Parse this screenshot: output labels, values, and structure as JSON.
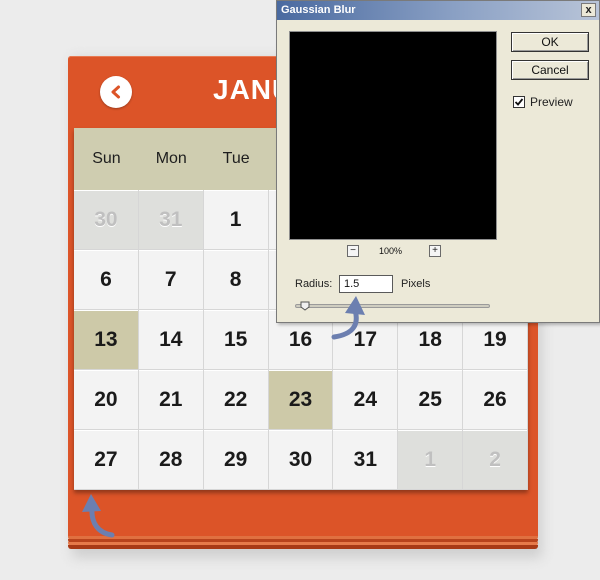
{
  "calendar": {
    "month_title": "JANU",
    "back_icon": "chevron-left-icon",
    "weekdays": [
      "Sun",
      "Mon",
      "Tue",
      "",
      "",
      "",
      ""
    ],
    "days": [
      {
        "label": "30",
        "state": "muted"
      },
      {
        "label": "31",
        "state": "muted"
      },
      {
        "label": "1",
        "state": "normal"
      },
      {
        "label": "",
        "state": "normal"
      },
      {
        "label": "",
        "state": "normal"
      },
      {
        "label": "",
        "state": "normal"
      },
      {
        "label": "",
        "state": "normal"
      },
      {
        "label": "6",
        "state": "normal"
      },
      {
        "label": "7",
        "state": "normal"
      },
      {
        "label": "8",
        "state": "normal"
      },
      {
        "label": "",
        "state": "normal"
      },
      {
        "label": "",
        "state": "normal"
      },
      {
        "label": "",
        "state": "normal"
      },
      {
        "label": "",
        "state": "normal"
      },
      {
        "label": "13",
        "state": "highlight"
      },
      {
        "label": "14",
        "state": "normal"
      },
      {
        "label": "15",
        "state": "normal"
      },
      {
        "label": "16",
        "state": "normal"
      },
      {
        "label": "17",
        "state": "normal"
      },
      {
        "label": "18",
        "state": "normal"
      },
      {
        "label": "19",
        "state": "normal"
      },
      {
        "label": "20",
        "state": "normal"
      },
      {
        "label": "21",
        "state": "normal"
      },
      {
        "label": "22",
        "state": "normal"
      },
      {
        "label": "23",
        "state": "highlight"
      },
      {
        "label": "24",
        "state": "normal"
      },
      {
        "label": "25",
        "state": "normal"
      },
      {
        "label": "26",
        "state": "normal"
      },
      {
        "label": "27",
        "state": "normal"
      },
      {
        "label": "28",
        "state": "normal"
      },
      {
        "label": "29",
        "state": "normal"
      },
      {
        "label": "30",
        "state": "normal"
      },
      {
        "label": "31",
        "state": "normal"
      },
      {
        "label": "1",
        "state": "muted"
      },
      {
        "label": "2",
        "state": "muted"
      }
    ],
    "colors": {
      "accent": "#dc5428",
      "weekday_bar": "#cfcdb0",
      "highlight": "#cdc9a8",
      "muted_cell": "#dedfdc",
      "page_edges": [
        "#e07040",
        "#b8431c",
        "#e67a4a",
        "#a83a16"
      ]
    }
  },
  "dialog": {
    "title": "Gaussian Blur",
    "close_label": "x",
    "ok_label": "OK",
    "cancel_label": "Cancel",
    "preview_label": "Preview",
    "preview_checked": true,
    "zoom_out_label": "−",
    "zoom_in_label": "+",
    "zoom_level": "100%",
    "radius_label": "Radius:",
    "radius_value": "1.5",
    "pixels_label": "Pixels",
    "slider_value": 0.05
  },
  "annotations": {
    "arrow_color": "#6c7fb0",
    "icon": "curved-arrow-icon"
  }
}
